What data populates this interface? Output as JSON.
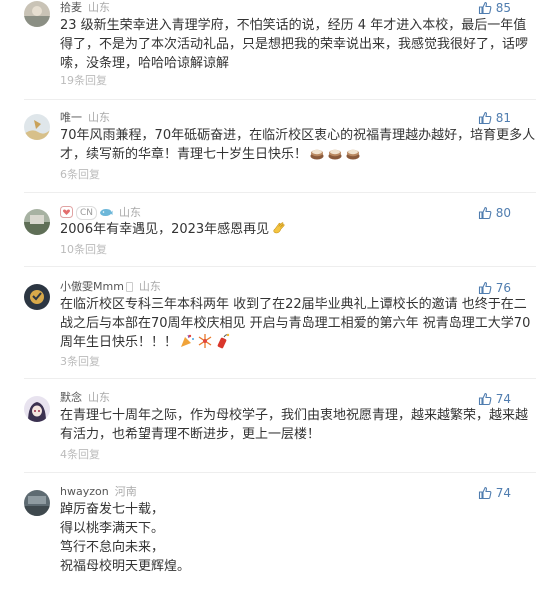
{
  "comments": [
    {
      "username": "拾麦",
      "region": "山东",
      "likes": "85",
      "text": "23 级新生荣幸进入青理学府，不怕笑话的说，经历 4 年才进入本校，最后一年值得了，不是为了本次活动礼品，只是想把我的荣幸说出来，我感觉我很好了，话啰嗦，没条理，哈哈哈谅解谅解",
      "replies": "19条回复"
    },
    {
      "username": "唯一",
      "region": "山东",
      "likes": "81",
      "text": "70年风雨兼程，70年砥砺奋进，在临沂校区衷心的祝福青理越办越好，培育更多人才，续写新的华章！青理七十岁生日快乐！",
      "emojis": [
        "cake-emoji",
        "cake-emoji",
        "cake-emoji"
      ],
      "replies": "6条回复"
    },
    {
      "username": "CN",
      "region": "山东",
      "likes": "80",
      "text": "2006年有幸遇见，2023年感恩再见",
      "emojis": [
        "clap-emoji"
      ],
      "replies": "10条回复"
    },
    {
      "username": "小傲雯Mmm",
      "region": "山东",
      "likes": "76",
      "text": "在临沂校区专科三年本科两年 收到了在22届毕业典礼上谭校长的邀请 也终于在二战之后与本部在70周年校庆相见 开启与青岛理工相爱的第六年 祝青岛理工大学70周年生日快乐！！！",
      "emojis": [
        "party-emoji",
        "fireworks-emoji",
        "firecracker-emoji"
      ],
      "replies": "3条回复"
    },
    {
      "username": "默念",
      "region": "山东",
      "likes": "74",
      "text": "在青理七十周年之际，作为母校学子，我们由衷地祝愿青理，越来越繁荣，越来越有活力，也希望青理不断进步，更上一层楼！",
      "replies": "4条回复"
    },
    {
      "username": "hwayzon",
      "region": "河南",
      "likes": "74",
      "text": "踔厉奋发七十载，\n得以桃李满天下。\n笃行不怠向未来，\n祝福母校明天更辉煌。",
      "replies": ""
    }
  ],
  "colors": {
    "like": "#507daf",
    "text": "#333333",
    "muted": "#aaaaaa"
  }
}
